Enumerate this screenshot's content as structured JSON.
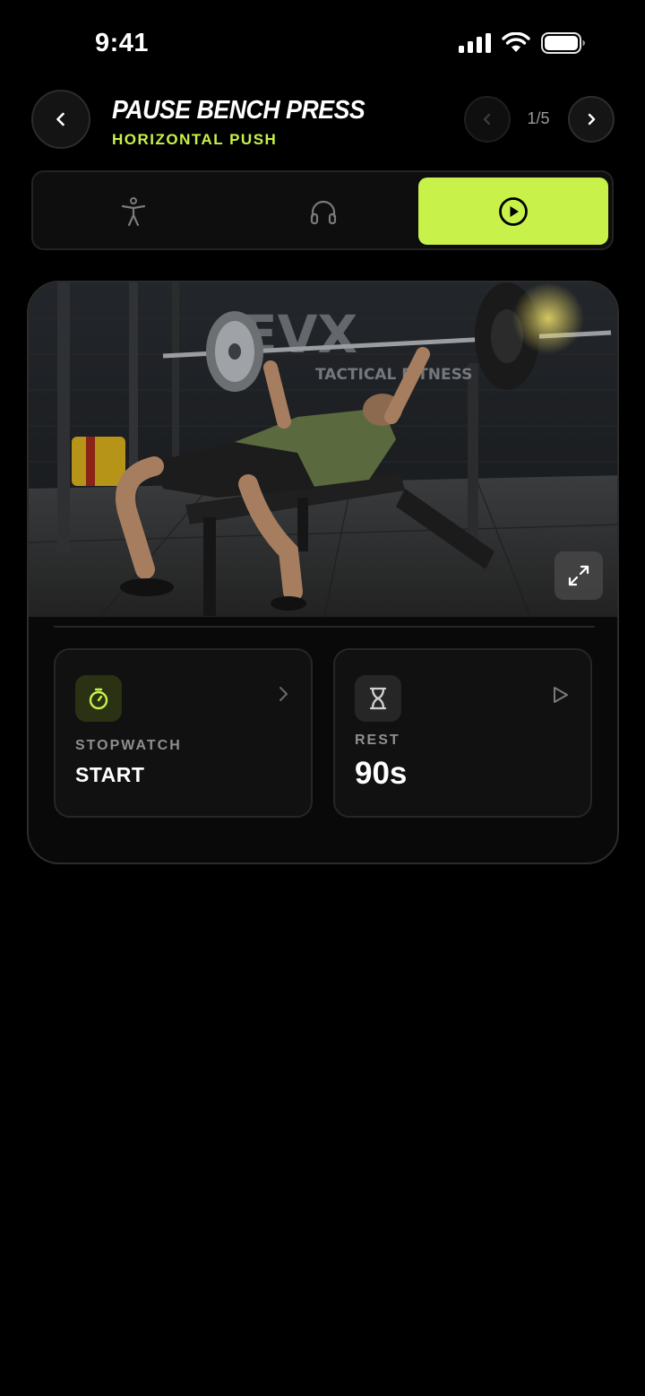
{
  "status_bar": {
    "time": "9:41"
  },
  "header": {
    "title": "PAUSE BENCH PRESS",
    "subtitle": "HORIZONTAL PUSH",
    "counter": "1/5"
  },
  "tabs": [
    {
      "icon": "body-figure-icon",
      "active": false
    },
    {
      "icon": "headphones-icon",
      "active": false
    },
    {
      "icon": "play-circle-icon",
      "active": true
    }
  ],
  "media": {
    "wall_text_large": "EVX",
    "wall_text_small": "TACTICAL FITNESS"
  },
  "tiles": {
    "stopwatch": {
      "label": "STOPWATCH",
      "value": "START"
    },
    "rest": {
      "label": "REST",
      "value": "90s"
    }
  },
  "colors": {
    "accent": "#c8f24a",
    "background": "#000000"
  }
}
